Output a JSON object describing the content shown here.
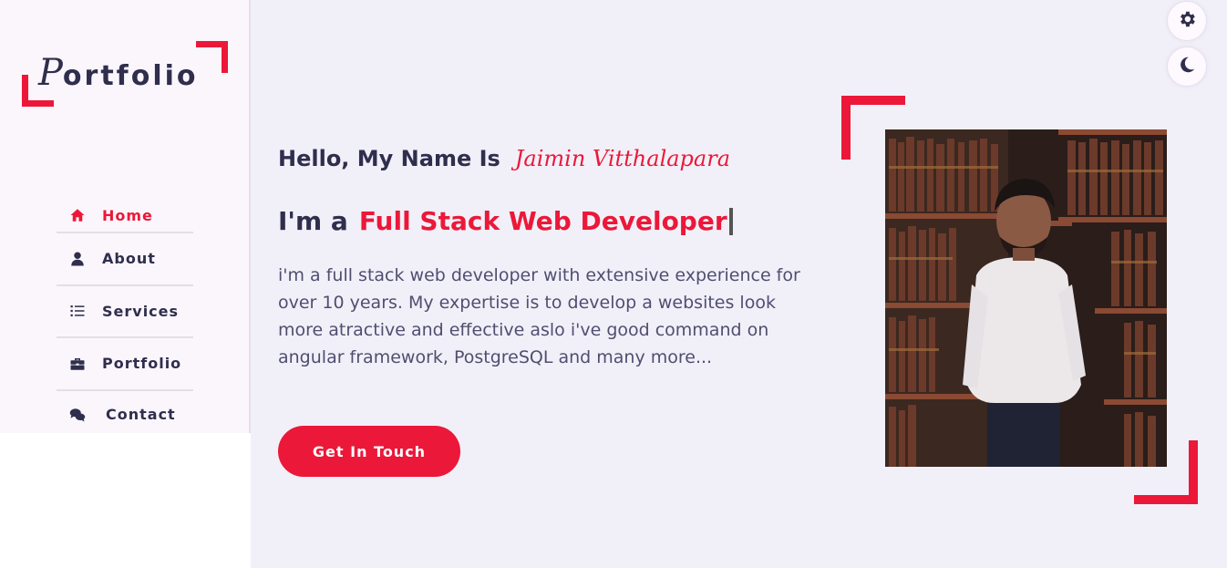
{
  "sidebar": {
    "logo": {
      "first": "P",
      "rest": "ortfolio"
    },
    "nav": [
      {
        "label": "Home",
        "icon": "home-icon",
        "active": true
      },
      {
        "label": "About",
        "icon": "user-icon"
      },
      {
        "label": "Services",
        "icon": "list-icon"
      },
      {
        "label": "Portfolio",
        "icon": "briefcase-icon"
      },
      {
        "label": "Contact",
        "icon": "comments-icon"
      }
    ]
  },
  "toolbar": {
    "settings_icon": "gear-icon",
    "theme_icon": "moon-icon"
  },
  "hero": {
    "greeting": "Hello, My Name Is",
    "name": "Jaimin Vitthalapara",
    "im_prefix": "I'm a",
    "role": "Full Stack Web Developer",
    "description": "i'm a full stack web developer with extensive experience for over 10 years. My expertise is to develop a websites look more atractive and effective aslo i've good command on angular framework, PostgreSQL and many more...",
    "cta_label": "Get In Touch"
  },
  "colors": {
    "accent": "#ec1839",
    "text": "#302e4d",
    "bg": "#f1f0f9"
  }
}
